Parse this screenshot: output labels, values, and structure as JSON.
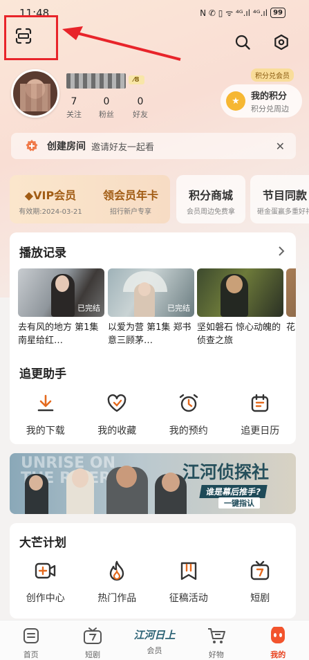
{
  "status": {
    "time": "11:48",
    "icons": "N ✆ ▯ ᯤ ⁴ᴳ.ıl ⁴ᴳ.ıl",
    "battery": "99"
  },
  "header": {
    "scan_icon": "scan-icon",
    "search_icon": "search-icon",
    "settings_icon": "settings-icon"
  },
  "profile": {
    "level": "8",
    "stats": [
      {
        "value": "7",
        "label": "关注"
      },
      {
        "value": "0",
        "label": "粉丝"
      },
      {
        "value": "0",
        "label": "好友"
      }
    ],
    "points_tag": "积分兑会员",
    "points_title": "我的积分",
    "points_sub": "积分兑周边"
  },
  "room": {
    "title": "创建房间",
    "subtitle": "邀请好友一起看",
    "close": "✕"
  },
  "cards": [
    {
      "title": "VIP会员",
      "sub": "有效期:2024-03-21"
    },
    {
      "title": "领会员年卡",
      "sub": "招行新户专享"
    },
    {
      "title": "积分商城",
      "sub": "会员周边免费拿"
    },
    {
      "title": "节目同款",
      "sub": "砸金蛋赢多重好礼"
    }
  ],
  "history": {
    "title": "播放记录",
    "items": [
      {
        "caption": "去有风的地方 第1集 南星给红…",
        "badge": "已完结"
      },
      {
        "caption": "以爱为营 第1集 郑书意三顾茅…",
        "badge": "已完结"
      },
      {
        "caption": "坚如磐石 惊心动魄的侦查之旅",
        "badge": ""
      },
      {
        "caption": "花 路",
        "badge": ""
      }
    ]
  },
  "helper": {
    "title": "追更助手",
    "items": [
      {
        "label": "我的下载",
        "icon": "download-icon"
      },
      {
        "label": "我的收藏",
        "icon": "favorite-heart-icon"
      },
      {
        "label": "我的预约",
        "icon": "alarm-clock-icon"
      },
      {
        "label": "追更日历",
        "icon": "calendar-icon"
      }
    ]
  },
  "banner": {
    "bg_text": "UNRISE ON THE RIVER",
    "title": "江河侦探社",
    "sub": "谁是幕后推手?",
    "cta": "一键指认"
  },
  "plan": {
    "title": "大芒计划",
    "items": [
      {
        "label": "创作中心",
        "icon": "video-plus-icon"
      },
      {
        "label": "热门作品",
        "icon": "flame-icon"
      },
      {
        "label": "征稿活动",
        "icon": "bookmark-icon"
      },
      {
        "label": "短剧",
        "icon": "tv-icon"
      }
    ]
  },
  "tabs": [
    {
      "label": "首页",
      "icon": "home-icon"
    },
    {
      "label": "短剧",
      "icon": "tv-icon"
    },
    {
      "label": "会员",
      "icon": "jiangheri-logo",
      "logo": "江河日上"
    },
    {
      "label": "好物",
      "icon": "cart-icon"
    },
    {
      "label": "我的",
      "icon": "mango-face-icon"
    }
  ],
  "colors": {
    "accent": "#e8421e",
    "annotation": "#e8242a",
    "vip_gold": "#a15c14",
    "icon_orange": "#e46a1e"
  }
}
